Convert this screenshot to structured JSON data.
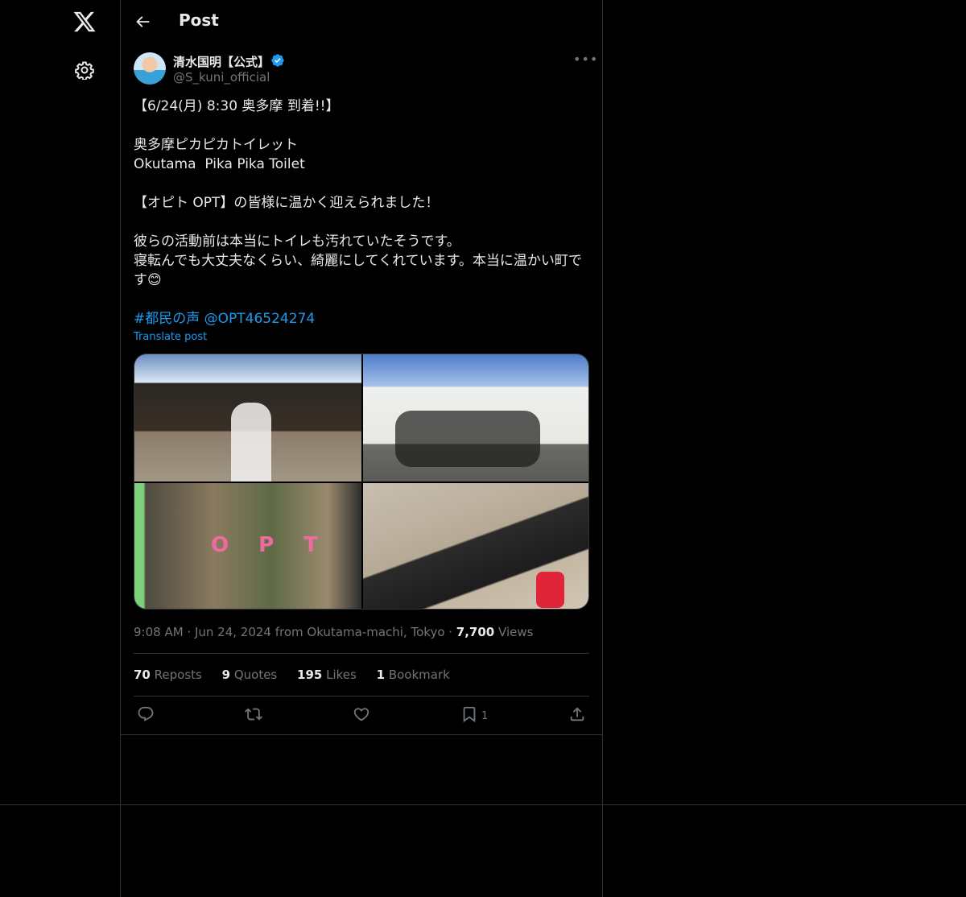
{
  "nav": {
    "logo_icon": "x-logo-icon",
    "settings_icon": "gear-icon"
  },
  "header": {
    "back_icon": "arrow-left-icon",
    "title": "Post"
  },
  "post": {
    "author_name": "清水国明【公式】",
    "handle": "@S_kuni_official",
    "verified_color": "#1d9bf0",
    "text": "【6/24(月) 8:30 奥多摩 到着!!】\n\n奥多摩ピカピカトイレット\nOkutama  Pika Pika Toilet\n\n【オピト OPT】の皆様に温かく迎えられました！\n\n彼らの活動前は本当にトイレも汚れていたそうです。\n寝転んでも大丈夫なくらい、綺麗にしてくれています。本当に温かい町です😊",
    "hashtag": "#都民の声",
    "mention": "@OPT46524274",
    "translate_label": "Translate post",
    "timestamp": "9:08 AM · Jun 24, 2024 from Okutama-machi, Tokyo · ",
    "views_count": "7,700",
    "views_label": " Views",
    "stats": [
      {
        "count": "70",
        "label": " Reposts"
      },
      {
        "count": "9",
        "label": " Quotes"
      },
      {
        "count": "195",
        "label": " Likes"
      },
      {
        "count": "1",
        "label": " Bookmark"
      }
    ],
    "bookmark_count": "1",
    "link_color": "#1d9bf0"
  }
}
